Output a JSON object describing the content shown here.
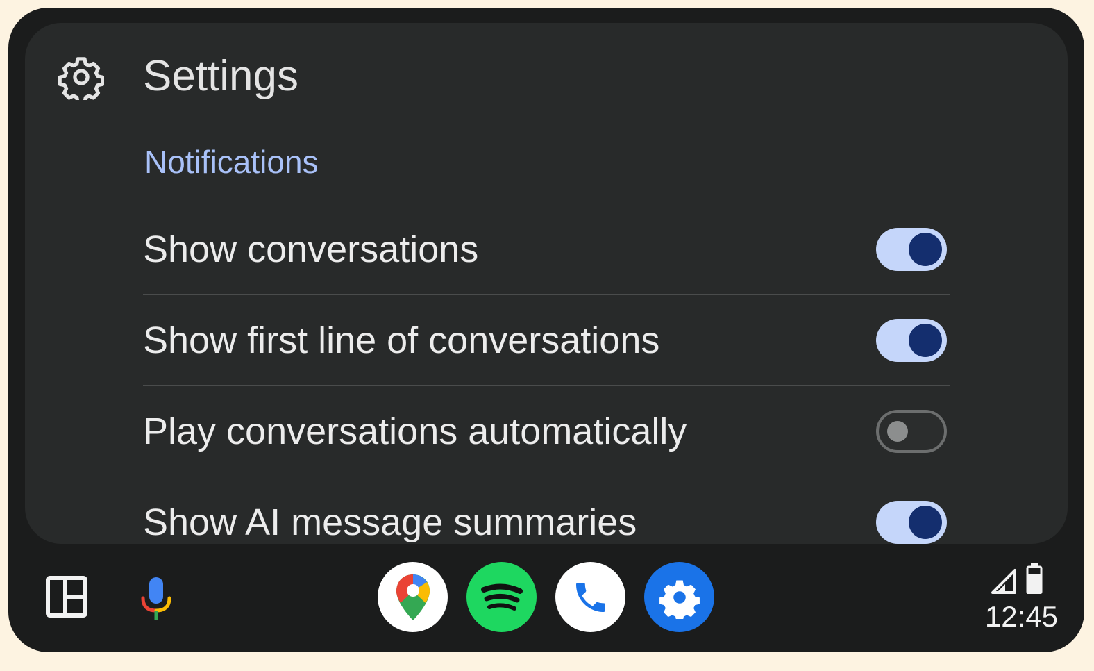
{
  "header": {
    "title": "Settings",
    "icon": "gear-icon"
  },
  "section": {
    "title": "Notifications"
  },
  "settings": [
    {
      "label": "Show conversations",
      "enabled": true
    },
    {
      "label": "Show first line of conversations",
      "enabled": true
    },
    {
      "label": "Play conversations automatically",
      "enabled": false
    },
    {
      "label": "Show AI message summaries",
      "enabled": true
    }
  ],
  "taskbar": {
    "left_icons": [
      "layout-dashboard-icon",
      "microphone-icon"
    ],
    "apps": [
      {
        "name": "maps-app-icon",
        "color": "#ffffff"
      },
      {
        "name": "spotify-app-icon",
        "color": "#1ed760"
      },
      {
        "name": "phone-app-icon",
        "color": "#ffffff"
      },
      {
        "name": "settings-app-icon",
        "color": "#1a73e8"
      }
    ]
  },
  "status": {
    "time": "12:45",
    "icons": [
      "signal-icon",
      "battery-icon"
    ]
  },
  "colors": {
    "accent": "#a9c1f8",
    "toggle_on_track": "#c5d6fa",
    "toggle_on_knob": "#142e6e",
    "card_background": "#282a2a",
    "device_background": "#1b1c1c"
  }
}
